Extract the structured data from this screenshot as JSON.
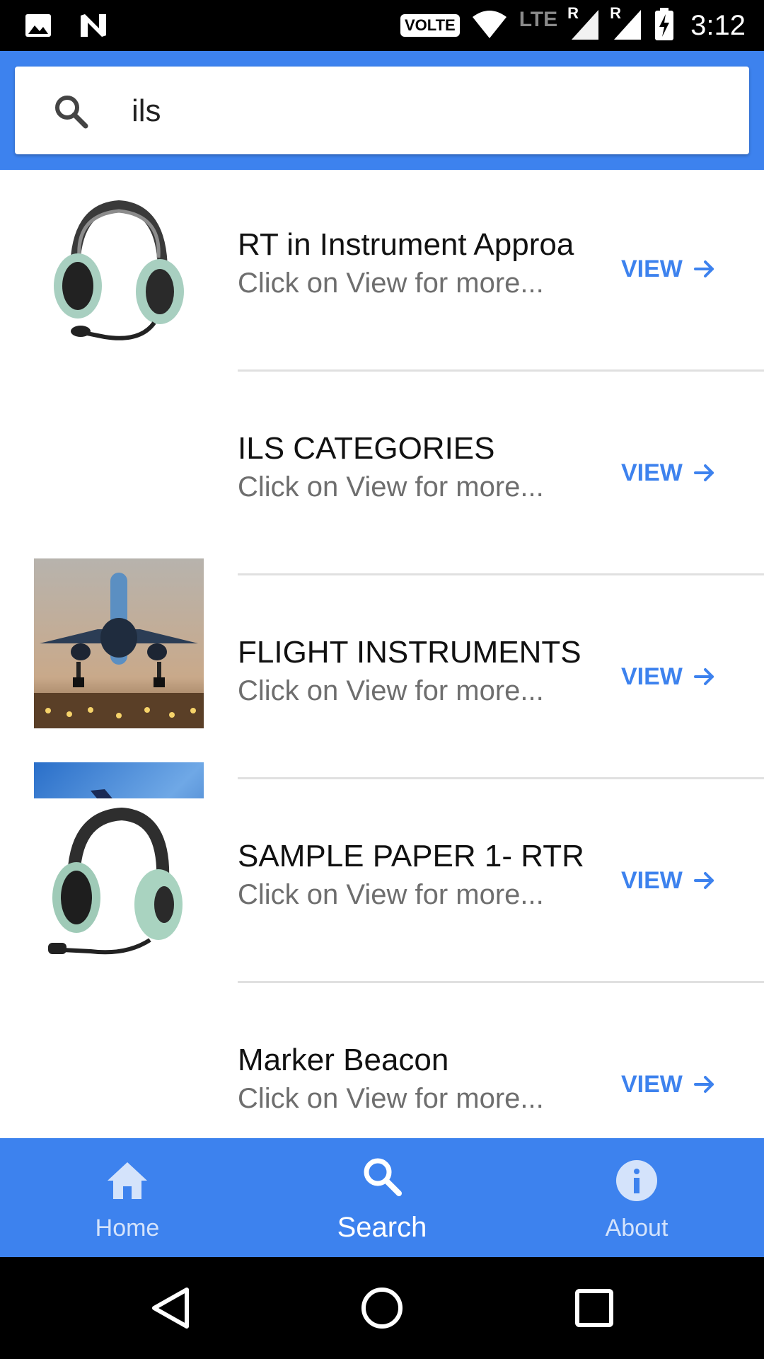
{
  "status_bar": {
    "volte": "VOLTE",
    "lte": "LTE",
    "roaming_1": "R",
    "roaming_2": "R",
    "time": "3:12"
  },
  "search": {
    "value": "ils",
    "icon": "search-icon"
  },
  "results": [
    {
      "title": "RT in Instrument Approa",
      "subtitle": "Click on View for more...",
      "action": "VIEW",
      "thumb": "headset-image"
    },
    {
      "title": "ILS CATEGORIES",
      "subtitle": "Click on View for more...",
      "action": "VIEW",
      "thumb": "landing-plane-image"
    },
    {
      "title": "FLIGHT INSTRUMENTS",
      "subtitle": "Click on View for more...",
      "action": "VIEW",
      "thumb": "plane-sky-image"
    },
    {
      "title": "SAMPLE PAPER 1- RTR",
      "subtitle": "Click on View for more...",
      "action": "VIEW",
      "thumb": "headset-image"
    },
    {
      "title": "Marker Beacon",
      "subtitle": "Click on View for more...",
      "action": "VIEW",
      "thumb": "plane-approach-image"
    }
  ],
  "bottom_nav": {
    "items": [
      {
        "label": "Home",
        "icon": "home-icon",
        "active": false
      },
      {
        "label": "Search",
        "icon": "search-icon",
        "active": true
      },
      {
        "label": "About",
        "icon": "info-icon",
        "active": false
      }
    ]
  },
  "colors": {
    "primary": "#3d82ee",
    "view_link": "#3d82ee"
  }
}
